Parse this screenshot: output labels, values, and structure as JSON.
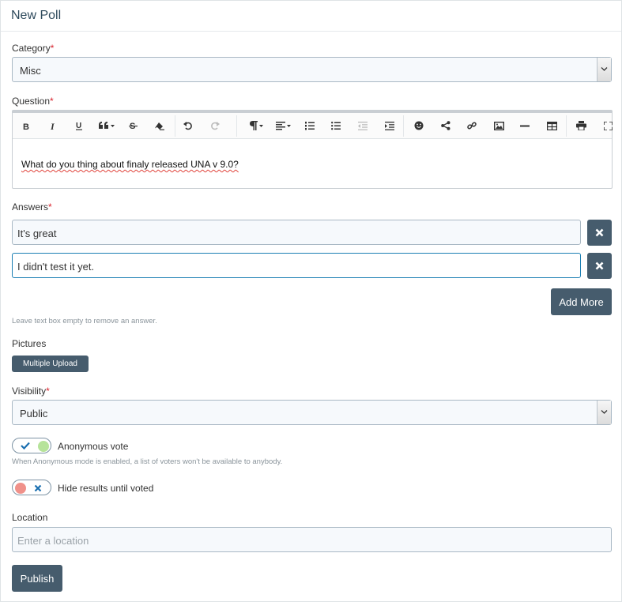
{
  "header": {
    "title": "New Poll"
  },
  "category": {
    "label": "Category",
    "required": "*",
    "value": "Misc"
  },
  "question": {
    "label": "Question",
    "required": "*",
    "text": "What do you thing about finaly released UNA v 9.0?",
    "toolbar": [
      "bold-icon",
      "italic-icon",
      "underline-icon",
      "blockquote-icon",
      "strikethrough-icon",
      "eraser-icon",
      "undo-icon",
      "redo-icon",
      "paragraph-icon",
      "align-icon",
      "numbered-list-icon",
      "bullet-list-icon",
      "outdent-icon",
      "indent-icon",
      "emoji-icon",
      "share-icon",
      "link-icon",
      "image-icon",
      "horizontal-rule-icon",
      "table-icon",
      "print-icon",
      "fullscreen-icon"
    ]
  },
  "answers": {
    "label": "Answers",
    "required": "*",
    "items": [
      {
        "value": "It's great"
      },
      {
        "value": "I didn't test it yet."
      }
    ],
    "add_more_label": "Add More",
    "hint": "Leave text box empty to remove an answer."
  },
  "pictures": {
    "label": "Pictures",
    "button_label": "Multiple Upload"
  },
  "visibility": {
    "label": "Visibility",
    "required": "*",
    "value": "Public"
  },
  "anonymous": {
    "label": "Anonymous vote",
    "state": "on",
    "hint": "When Anonymous mode is enabled, a list of voters won't be available to anybody."
  },
  "hide_results": {
    "label": "Hide results until voted",
    "state": "off"
  },
  "location": {
    "label": "Location",
    "placeholder": "Enter a location"
  },
  "publish": {
    "label": "Publish"
  },
  "colors": {
    "accent_dark": "#465c6d",
    "focus_border": "#1b7fb3",
    "required": "#d9232d",
    "toggle_on": "#b6e39a",
    "toggle_off": "#f0918a",
    "mark": "#1a6fb0"
  }
}
